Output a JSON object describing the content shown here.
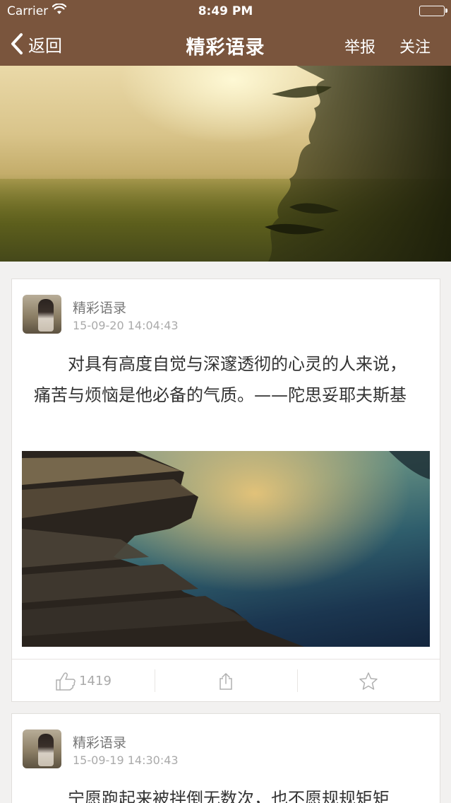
{
  "status_bar": {
    "carrier": "Carrier",
    "time": "8:49 PM"
  },
  "nav": {
    "back_label": "返回",
    "title": "精彩语录",
    "report_label": "举报",
    "follow_label": "关注"
  },
  "posts": [
    {
      "author": "精彩语录",
      "timestamp": "15-09-20 14:04:43",
      "text": "对具有高度自觉与深邃透彻的心灵的人来说，痛苦与烦恼是他必备的气质。——陀思妥耶夫斯基",
      "like_count": "1419"
    },
    {
      "author": "精彩语录",
      "timestamp": "15-09-19 14:30:43",
      "text": "宁愿跑起来被拌倒无数次，也不愿规规矩矩"
    }
  ],
  "colors": {
    "nav_background": "#7a553d",
    "page_background": "#f2f1f0"
  },
  "icons": {
    "back": "chevron-left-icon",
    "wifi": "wifi-icon",
    "battery": "battery-icon",
    "like": "thumbs-up-icon",
    "share": "share-icon",
    "favorite": "star-icon"
  }
}
